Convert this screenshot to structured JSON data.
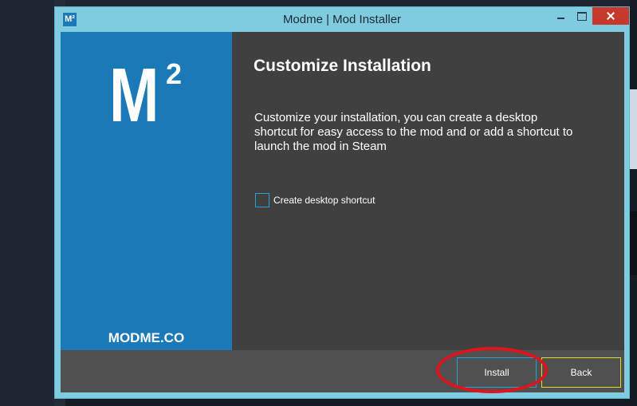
{
  "window": {
    "title": "Modme | Mod Installer",
    "app_icon_text": "M²"
  },
  "brand": {
    "logo_main": "M",
    "logo_superscript": "2",
    "site": "MODME.CO",
    "color": "#1a79b6"
  },
  "page": {
    "heading": "Customize Installation",
    "description": "Customize your installation, you can create a desktop shortcut for easy access to the mod and or add a shortcut to launch the mod in Steam",
    "checkbox_label": "Create desktop shortcut",
    "checkbox_checked": false
  },
  "footer": {
    "install_label": "Install",
    "back_label": "Back"
  },
  "colors": {
    "accent_blue": "#27a0d9",
    "back_border": "#e0e024",
    "highlight_ring": "#e0131e",
    "close_button": "#c7392c"
  }
}
